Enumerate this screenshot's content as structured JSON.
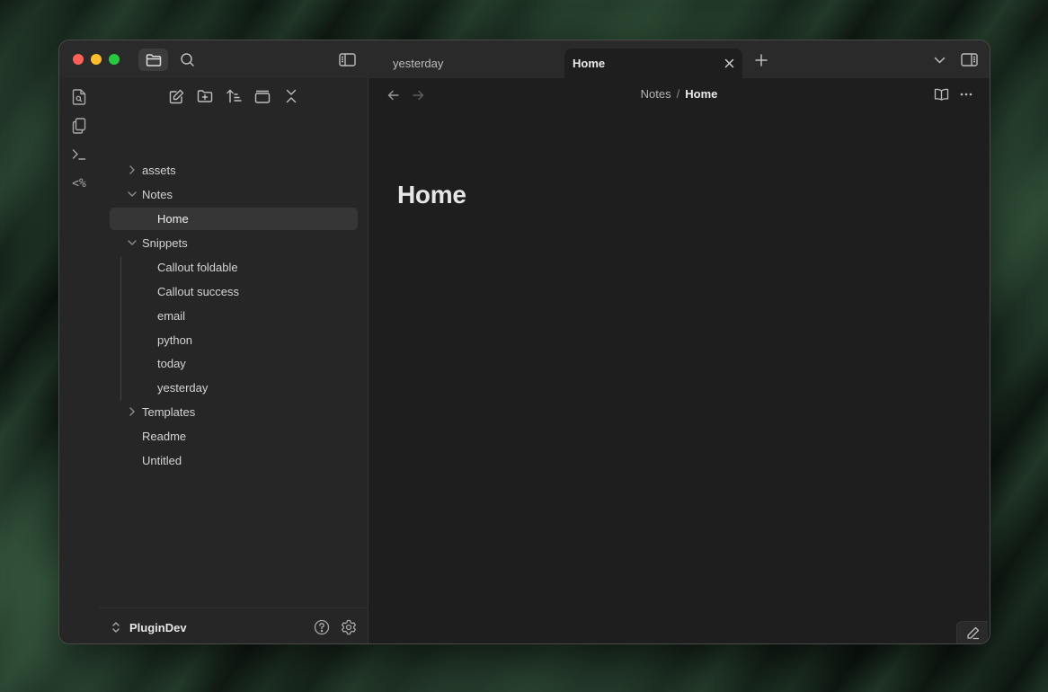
{
  "tabs": [
    {
      "label": "yesterday",
      "active": false
    },
    {
      "label": "Home",
      "active": true
    }
  ],
  "ribbon": {
    "template_label": "<%"
  },
  "file_tree": {
    "items": [
      {
        "label": "assets",
        "type": "folder",
        "expanded": false
      },
      {
        "label": "Notes",
        "type": "folder",
        "expanded": true
      },
      {
        "label": "Home",
        "type": "file",
        "active": true
      },
      {
        "label": "Snippets",
        "type": "folder",
        "expanded": true
      },
      {
        "label": "Callout foldable",
        "type": "file"
      },
      {
        "label": "Callout success",
        "type": "file"
      },
      {
        "label": "email",
        "type": "file"
      },
      {
        "label": "python",
        "type": "file"
      },
      {
        "label": "today",
        "type": "file"
      },
      {
        "label": "yesterday",
        "type": "file"
      },
      {
        "label": "Templates",
        "type": "folder",
        "expanded": false
      },
      {
        "label": "Readme",
        "type": "file"
      },
      {
        "label": "Untitled",
        "type": "file"
      }
    ]
  },
  "vault": {
    "name": "PluginDev"
  },
  "editor": {
    "breadcrumb": [
      "Notes",
      "Home"
    ],
    "breadcrumb_separator": "/",
    "title": "Home"
  },
  "icons": {
    "titlebar": [
      "folder-icon",
      "search-icon",
      "sidebar-left-icon",
      "close-icon",
      "plus-icon",
      "chevron-down-icon",
      "sidebar-right-icon"
    ],
    "ribbon": [
      "file-search-icon",
      "files-icon",
      "terminal-icon",
      "templater-icon"
    ],
    "nav_actions": [
      "new-note-icon",
      "new-folder-icon",
      "sort-icon",
      "collapse-view-icon",
      "collapse-all-icon"
    ]
  },
  "colors": {
    "window_bg": "#1e1e1e",
    "sidebar_bg": "#262626",
    "titlebar_bg": "#2a2a2a",
    "active_item_bg": "#363636",
    "traffic_red": "#fe5f57",
    "traffic_yellow": "#febc2e",
    "traffic_green": "#28c840"
  }
}
